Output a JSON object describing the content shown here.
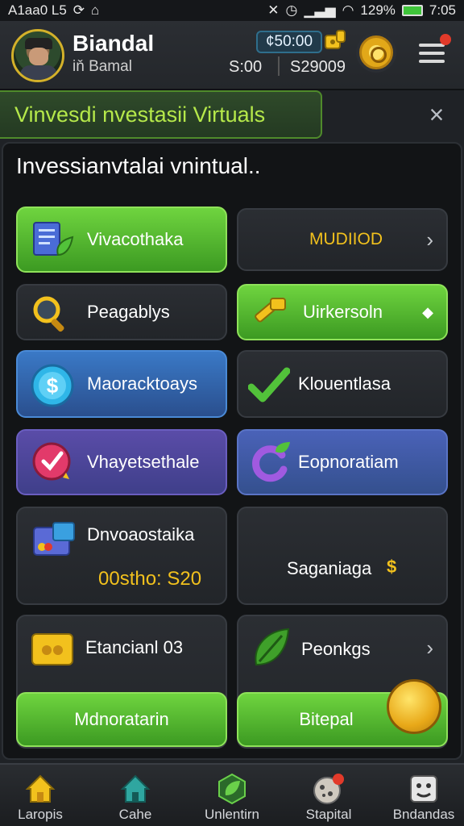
{
  "status_bar": {
    "left_text": "A1aa0 L5",
    "battery": "129%",
    "time": "7:05"
  },
  "header": {
    "user_name": "Biandal",
    "user_sub": "iň Bamal",
    "balance": "¢50:00",
    "stat_a": "S:00",
    "stat_b": "S29009"
  },
  "banner": {
    "title": "Vinvesdi nvestasii Virtuals",
    "close": "×"
  },
  "panel": {
    "title": "Invessianvtalai vnintual.."
  },
  "tiles": [
    {
      "label": "Vivacothaka"
    },
    {
      "label": "MUDIIOD",
      "arrow": "›"
    },
    {
      "label": "Peagablys"
    },
    {
      "label": "Uirkersoln",
      "arrow": "◆"
    },
    {
      "label": "Maoracktoays"
    },
    {
      "label": "Klouentlasa"
    },
    {
      "label": "Vhayetsethale"
    },
    {
      "label": "Eopnoratiam"
    },
    {
      "label": "Dnvoaostaika",
      "value": "00stho: S20"
    },
    {
      "label": "Saganiaga",
      "value": "$"
    },
    {
      "label": "Etancianl 03"
    },
    {
      "label": "Peonkgs",
      "arrow": "›"
    }
  ],
  "buttons": {
    "left": "Mdnoratarin",
    "right": "Bitepal"
  },
  "nav": [
    {
      "label": "Laropis",
      "icon": "home-icon"
    },
    {
      "label": "Cahe",
      "icon": "house-icon"
    },
    {
      "label": "Unlentirn",
      "icon": "leaf-badge-icon"
    },
    {
      "label": "Stapital",
      "icon": "cookie-icon"
    },
    {
      "label": "Bndandas",
      "icon": "grid-face-icon"
    }
  ],
  "colors": {
    "accent_green": "#5cc22f",
    "gold": "#e8b420",
    "background": "#1f2226"
  }
}
